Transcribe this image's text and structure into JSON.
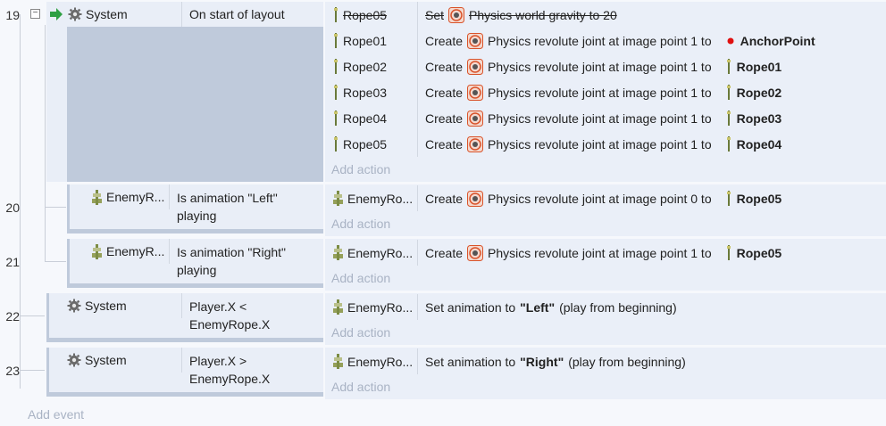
{
  "events": [
    {
      "number": "19",
      "condition": {
        "object": "System",
        "text": "On start of layout"
      },
      "actions": [
        {
          "object": "Rope05",
          "verb": "Set",
          "text": "Physics world gravity to 20",
          "target": "",
          "disabled": true
        },
        {
          "object": "Rope01",
          "verb": "Create",
          "text": "Physics revolute joint at image point 1 to",
          "target": "AnchorPoint",
          "disabled": false
        },
        {
          "object": "Rope02",
          "verb": "Create",
          "text": "Physics revolute joint at image point 1 to",
          "target": "Rope01",
          "disabled": false
        },
        {
          "object": "Rope03",
          "verb": "Create",
          "text": "Physics revolute joint at image point 1 to",
          "target": "Rope02",
          "disabled": false
        },
        {
          "object": "Rope04",
          "verb": "Create",
          "text": "Physics revolute joint at image point 1 to",
          "target": "Rope03",
          "disabled": false
        },
        {
          "object": "Rope05",
          "verb": "Create",
          "text": "Physics revolute joint at image point 1 to",
          "target": "Rope04",
          "disabled": false
        }
      ]
    },
    {
      "number": "20",
      "condition": {
        "object": "EnemyR...",
        "line1": "Is animation \"Left\"",
        "line2": "playing"
      },
      "action": {
        "object": "EnemyRo...",
        "verb": "Create",
        "text": "Physics revolute joint at image point 0 to",
        "target": "Rope05"
      }
    },
    {
      "number": "21",
      "condition": {
        "object": "EnemyR...",
        "line1": "Is animation \"Right\"",
        "line2": "playing"
      },
      "action": {
        "object": "EnemyRo...",
        "verb": "Create",
        "text": "Physics revolute joint at image point 1 to",
        "target": "Rope05"
      }
    },
    {
      "number": "22",
      "condition": {
        "object": "System",
        "line1": "Player.X <",
        "line2": "EnemyRope.X"
      },
      "action": {
        "object": "EnemyRo...",
        "prefix": "Set animation to",
        "value": "\"Left\"",
        "suffix": "(play from beginning)"
      }
    },
    {
      "number": "23",
      "condition": {
        "object": "System",
        "line1": "Player.X >",
        "line2": "EnemyRope.X"
      },
      "action": {
        "object": "EnemyRo...",
        "prefix": "Set animation to",
        "value": "\"Right\"",
        "suffix": "(play from beginning)"
      }
    }
  ],
  "add_action_label": "Add action",
  "add_event_label": "Add event",
  "collapse_symbol": "−",
  "icons": {
    "system": "gear-icon",
    "run": "green-arrow-icon",
    "physics": "physics-behavior-icon",
    "rope": "rope-sprite-icon",
    "enemy": "enemy-rope-sprite-icon",
    "anchor": "red-dot-icon"
  },
  "colors": {
    "anchor": "#e01010",
    "physics": "#d9532a",
    "arrow": "#2ea043"
  }
}
